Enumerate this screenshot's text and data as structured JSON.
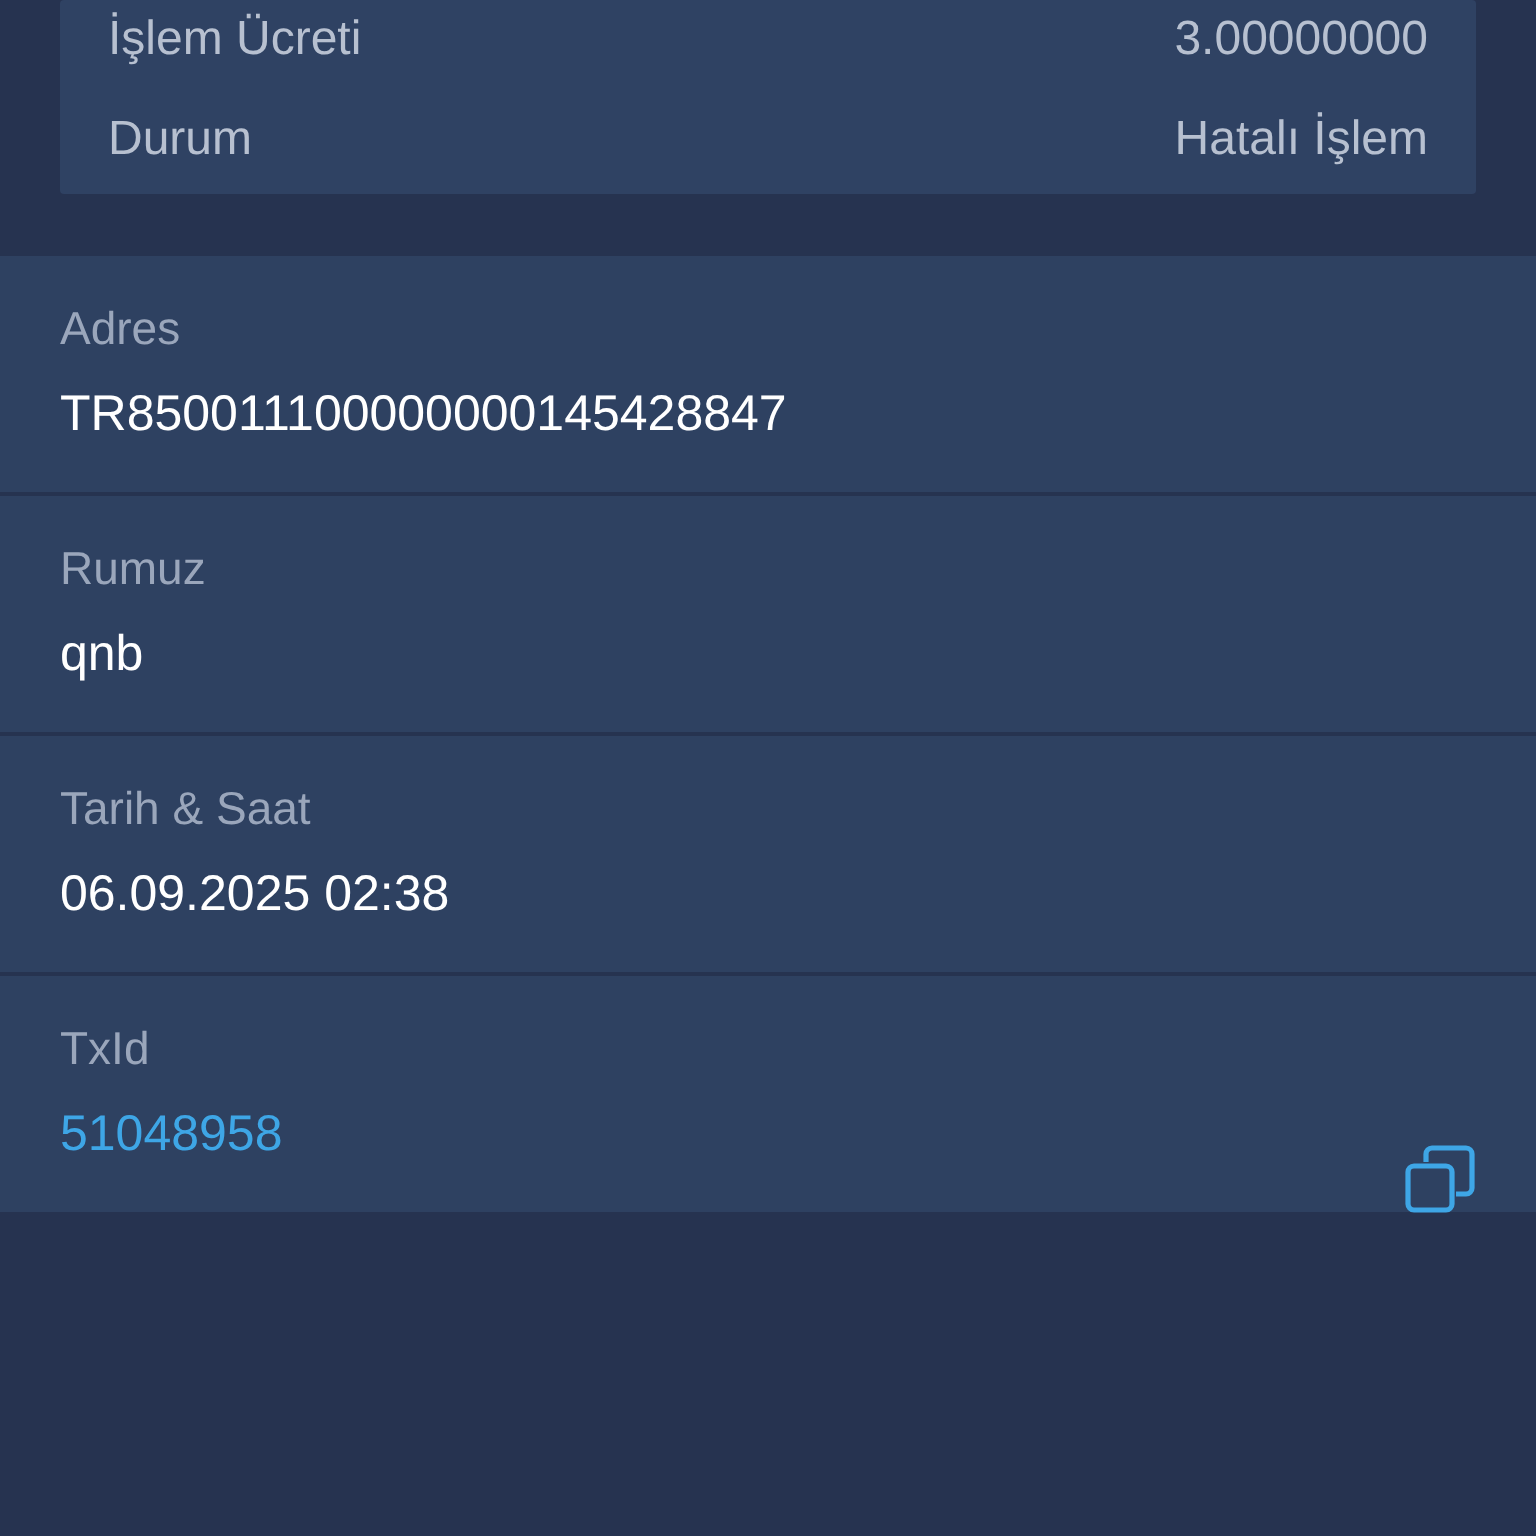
{
  "summary": [
    {
      "label": "İşlem Ücreti",
      "value": "3.00000000"
    },
    {
      "label": "Durum",
      "value": "Hatalı İşlem"
    }
  ],
  "details": [
    {
      "label": "Adres",
      "value": "TR850011100000000145428847",
      "kind": "text"
    },
    {
      "label": "Rumuz",
      "value": "qnb",
      "kind": "text"
    },
    {
      "label": "Tarih & Saat",
      "value": "06.09.2025 02:38",
      "kind": "text"
    },
    {
      "label": "TxId",
      "value": "51048958",
      "kind": "link"
    }
  ]
}
